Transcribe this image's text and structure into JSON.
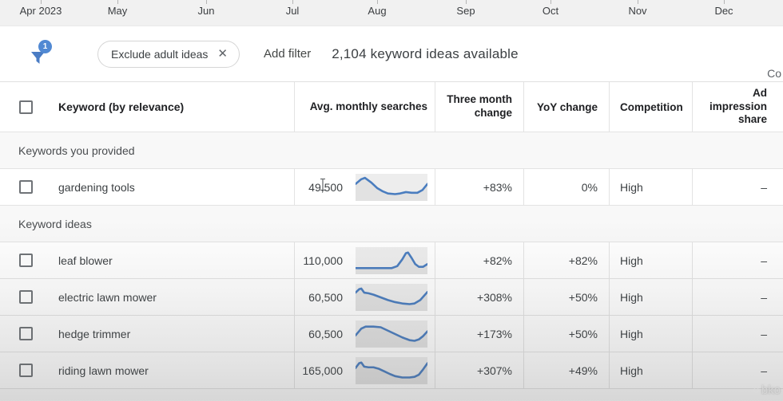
{
  "timeline": {
    "months": [
      "Apr 2023",
      "May",
      "Jun",
      "Jul",
      "Aug",
      "Sep",
      "Oct",
      "Nov",
      "Dec"
    ]
  },
  "filter_bar": {
    "filter_badge_count": "1",
    "chip_label": "Exclude adult ideas",
    "chip_close": "✕",
    "add_filter_label": "Add filter",
    "ideas_available": "2,104 keyword ideas available",
    "columns_label_cut": "Co"
  },
  "table": {
    "headers": {
      "keyword": "Keyword (by relevance)",
      "avg_monthly": "Avg. monthly searches",
      "three_month": "Three month change",
      "yoy": "YoY change",
      "competition": "Competition",
      "ad_share": "Ad impression share"
    },
    "sections": [
      {
        "label": "Keywords you provided",
        "rows": [
          {
            "keyword": "gardening tools",
            "avg": "49,500",
            "three_month": "+83%",
            "yoy": "0%",
            "competition": "High",
            "ad_share": "–",
            "cursor": true,
            "spark": [
              [
                0,
                15
              ],
              [
                8,
                8
              ],
              [
                13,
                6
              ],
              [
                22,
                13
              ],
              [
                30,
                21
              ],
              [
                38,
                26
              ],
              [
                45,
                29
              ],
              [
                55,
                30
              ],
              [
                62,
                29
              ],
              [
                70,
                27
              ],
              [
                78,
                28
              ],
              [
                86,
                28
              ],
              [
                93,
                24
              ],
              [
                100,
                15
              ]
            ]
          }
        ]
      },
      {
        "label": "Keyword ideas",
        "rows": [
          {
            "keyword": "leaf blower",
            "avg": "110,000",
            "three_month": "+82%",
            "yoy": "+82%",
            "competition": "High",
            "ad_share": "–",
            "cursor": false,
            "spark": [
              [
                0,
                31
              ],
              [
                20,
                31
              ],
              [
                40,
                31
              ],
              [
                50,
                31
              ],
              [
                58,
                28
              ],
              [
                65,
                18
              ],
              [
                70,
                9
              ],
              [
                73,
                8
              ],
              [
                78,
                16
              ],
              [
                83,
                25
              ],
              [
                88,
                29
              ],
              [
                94,
                29
              ],
              [
                100,
                25
              ]
            ]
          },
          {
            "keyword": "electric lawn mower",
            "avg": "60,500",
            "three_month": "+308%",
            "yoy": "+50%",
            "competition": "High",
            "ad_share": "–",
            "cursor": false,
            "spark": [
              [
                0,
                13
              ],
              [
                5,
                8
              ],
              [
                8,
                7
              ],
              [
                12,
                13
              ],
              [
                18,
                14
              ],
              [
                25,
                16
              ],
              [
                35,
                20
              ],
              [
                45,
                24
              ],
              [
                55,
                27
              ],
              [
                65,
                29
              ],
              [
                75,
                30
              ],
              [
                82,
                29
              ],
              [
                90,
                24
              ],
              [
                100,
                12
              ]
            ]
          },
          {
            "keyword": "hedge trimmer",
            "avg": "60,500",
            "three_month": "+173%",
            "yoy": "+50%",
            "competition": "High",
            "ad_share": "–",
            "cursor": false,
            "spark": [
              [
                0,
                22
              ],
              [
                8,
                12
              ],
              [
                14,
                9
              ],
              [
                25,
                9
              ],
              [
                35,
                10
              ],
              [
                45,
                15
              ],
              [
                55,
                20
              ],
              [
                65,
                25
              ],
              [
                75,
                29
              ],
              [
                82,
                30
              ],
              [
                88,
                28
              ],
              [
                94,
                23
              ],
              [
                100,
                16
              ]
            ]
          },
          {
            "keyword": "riding lawn mower",
            "avg": "165,000",
            "three_month": "+307%",
            "yoy": "+49%",
            "competition": "High",
            "ad_share": "–",
            "cursor": false,
            "spark": [
              [
                0,
                16
              ],
              [
                5,
                9
              ],
              [
                8,
                8
              ],
              [
                12,
                14
              ],
              [
                18,
                15
              ],
              [
                25,
                15
              ],
              [
                32,
                17
              ],
              [
                40,
                21
              ],
              [
                48,
                25
              ],
              [
                55,
                28
              ],
              [
                65,
                30
              ],
              [
                75,
                30
              ],
              [
                82,
                29
              ],
              [
                88,
                26
              ],
              [
                94,
                18
              ],
              [
                100,
                9
              ]
            ]
          }
        ]
      }
    ]
  },
  "watermark": {
    "text": "bko"
  },
  "colors": {
    "spark_line": "#4a7dbf",
    "spark_bg": "#ededed",
    "spark_fill": "#e2e2e2",
    "accent_blue": "#4a7cc4",
    "badge_blue": "#5189d3"
  }
}
